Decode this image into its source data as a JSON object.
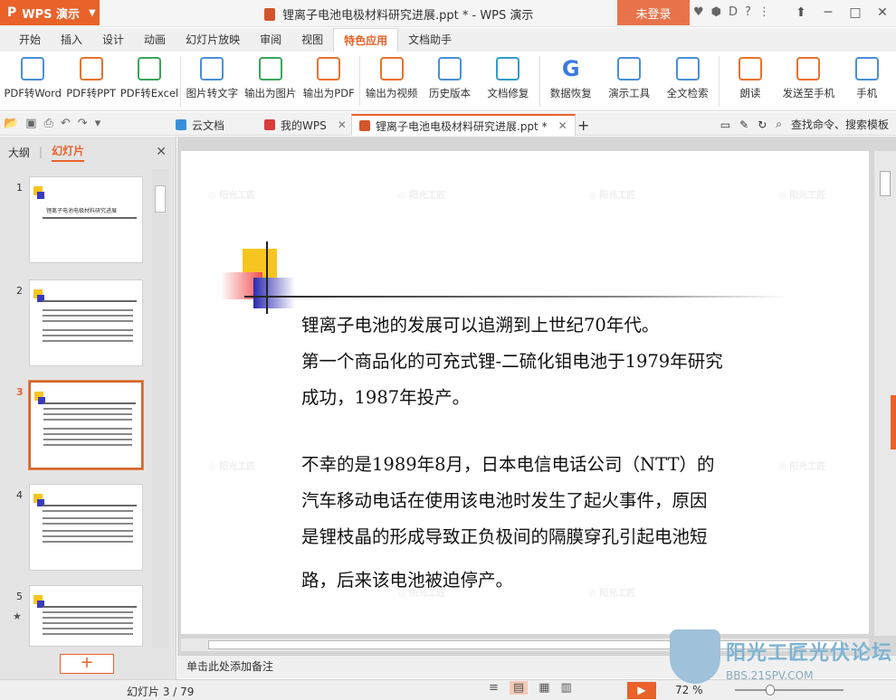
{
  "app": {
    "name": "WPS 演示",
    "window_title": "锂离子电池电极材料研究进展.ppt * - WPS 演示",
    "login_label": "未登录"
  },
  "menu_tabs": [
    "开始",
    "插入",
    "设计",
    "动画",
    "幻灯片放映",
    "审阅",
    "视图",
    "特色应用",
    "文档助手"
  ],
  "ribbon": [
    "PDF转Word",
    "PDF转PPT",
    "PDF转Excel",
    "图片转文字",
    "输出为图片",
    "输出为PDF",
    "输出为视频",
    "历史版本",
    "文档修复",
    "数据恢复",
    "演示工具",
    "全文检索",
    "朗读",
    "发送至手机",
    "手机"
  ],
  "doc_tabs": [
    "云文档",
    "我的WPS",
    "锂离子电池电极材料研究进展.ppt *"
  ],
  "search_label": "查找命令、搜索模板",
  "left_panel": {
    "tab_outline": "大纲",
    "tab_slides": "幻灯片",
    "slide_numbers": [
      "1",
      "2",
      "3",
      "4",
      "5"
    ],
    "thumb1_title": "锂离子电池电极材料研究进展"
  },
  "slide": {
    "lines": [
      "锂离子电池的发展可以追溯到上世纪70年代。",
      "第一个商品化的可充式锂-二硫化钼电池于1979年研究",
      "成功，1987年投产。",
      "不幸的是1989年8月，日本电信电话公司（NTT）的",
      "汽车移动电话在使用该电池时发生了起火事件，原因",
      "是锂枝晶的形成导致正负极间的隔膜穿孔引起电池短",
      "路，后来该电池被迫停产。"
    ]
  },
  "notes_placeholder": "单击此处添加备注",
  "status": {
    "slide_count": "幻灯片 3 / 79",
    "zoom": "72 %"
  },
  "brand": {
    "title": "阳光工匠光伏论坛",
    "url": "BBS.21SPV.COM"
  }
}
